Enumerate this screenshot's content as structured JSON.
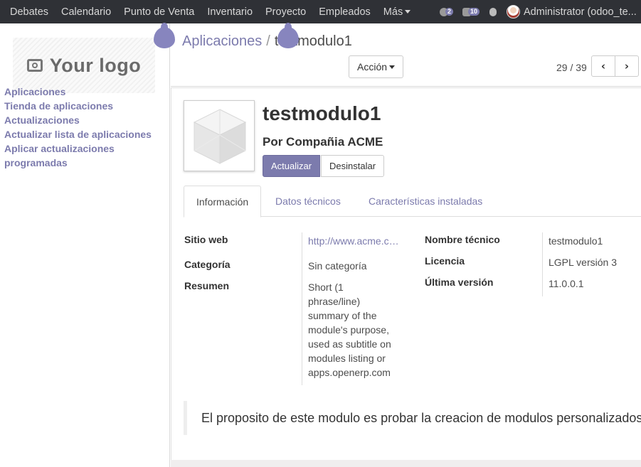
{
  "navbar": {
    "menus": [
      "Debates",
      "Calendario",
      "Punto de Venta",
      "Inventario",
      "Proyecto",
      "Empleados",
      "Más"
    ],
    "activity_count": "2",
    "messages_count": "10",
    "user_name": "Administrator (odoo_te..."
  },
  "sidebar": {
    "logo_text": "Your logo",
    "links": [
      "Aplicaciones",
      "Tienda de aplicaciones",
      "Actualizaciones",
      "Actualizar lista de aplicaciones",
      "Aplicar actualizaciones programadas"
    ]
  },
  "control_panel": {
    "breadcrumb_parent": "Aplicaciones",
    "breadcrumb_separator": "/",
    "breadcrumb_current": "testmodulo1",
    "action_label": "Acción",
    "pager": "29 / 39"
  },
  "module": {
    "name": "testmodulo1",
    "author": "Por Compañia ACME",
    "buttons": {
      "upgrade": "Actualizar",
      "uninstall": "Desinstalar"
    },
    "tabs": [
      "Información",
      "Datos técnicos",
      "Características instaladas"
    ],
    "fields_left": {
      "website_label": "Sitio web",
      "website_value": "http://www.acme.com",
      "category_label": "Categoría",
      "category_value": "Sin categoría",
      "summary_label": "Resumen",
      "summary_lines": [
        "Short (1",
        "phrase/line)",
        "summary of the",
        "module's purpose,",
        "used as subtitle on",
        "modules listing or",
        "apps.openerp.com"
      ]
    },
    "fields_right": {
      "technical_name_label": "Nombre técnico",
      "technical_name_value": "testmodulo1",
      "license_label": "Licencia",
      "license_value": "LGPL versión 3",
      "version_label": "Última versión",
      "version_value": "11.0.0.1"
    },
    "description": "El proposito de este modulo es probar la creacion de modulos personalizados"
  },
  "colors": {
    "navbar_bg": "#2f3136",
    "accent": "#7c7bad",
    "marker": "#8785be"
  }
}
